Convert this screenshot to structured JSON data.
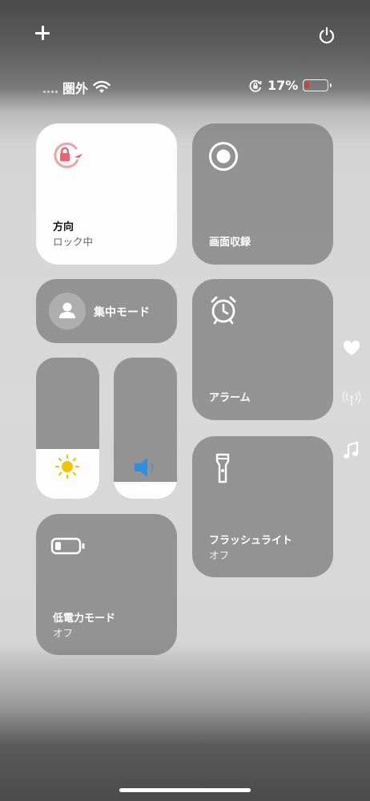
{
  "top_bar": {
    "add_icon": "plus-icon",
    "power_icon": "power-icon"
  },
  "status_bar": {
    "carrier": "圏外",
    "battery_percent": "17%",
    "battery_level": 0.17,
    "battery_color": "#e8362f"
  },
  "tiles": {
    "orientation": {
      "label": "方向",
      "sub": "ロック中",
      "accent": "#f0636a"
    },
    "screen_record": {
      "label": "画面収録"
    },
    "focus": {
      "label": "集中モード"
    },
    "alarm": {
      "label": "アラーム"
    },
    "flashlight": {
      "label": "フラッシュライト",
      "sub": "オフ"
    },
    "low_power": {
      "label": "低電力モード",
      "sub": "オフ"
    }
  },
  "sliders": {
    "brightness": {
      "level": 0.35,
      "icon": "sun-icon",
      "icon_color": "#f5c400"
    },
    "volume": {
      "level": 0.12,
      "icon": "speaker-icon",
      "icon_color": "#2f8ee0"
    }
  },
  "side_pages": [
    "heart-icon",
    "antenna-icon",
    "music-note-icon"
  ]
}
